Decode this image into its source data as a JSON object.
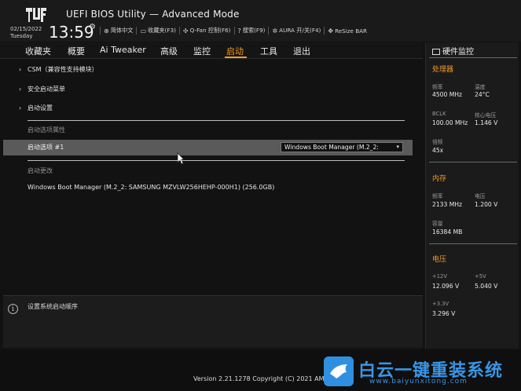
{
  "header": {
    "title": "UEFI BIOS Utility — Advanced Mode",
    "date": "02/15/2022",
    "weekday": "Tuesday",
    "time": "13:59",
    "toolbar": [
      {
        "icon": "globe-icon",
        "label": "简体中文"
      },
      {
        "icon": "favorites-icon",
        "label": "收藏夹(F3)"
      },
      {
        "icon": "fan-icon",
        "label": "Q-Fan 控制(F6)"
      },
      {
        "icon": "help-icon",
        "label": "搜索(F9)"
      },
      {
        "icon": "aura-icon",
        "label": "AURA 开/关(F4)"
      },
      {
        "icon": "resize-bar-icon",
        "label": "ReSize BAR"
      }
    ]
  },
  "menu": {
    "tabs": [
      "收藏夹",
      "概要",
      "Ai Tweaker",
      "高级",
      "监控",
      "启动",
      "工具",
      "退出"
    ],
    "active": "启动"
  },
  "main": {
    "items": [
      "CSM（兼容性支持模块）",
      "安全启动菜单",
      "启动设置"
    ],
    "boot_option_priorities_label": "启动选项属性",
    "boot_option_label": "启动选项 #1",
    "boot_option_value": "Windows Boot Manager (M.2_2:",
    "boot_override_label": "启动更改",
    "boot_override_entry": "Windows Boot Manager (M.2_2: SAMSUNG MZVLW256HEHP-000H1) (256.0GB)"
  },
  "help": {
    "text": "设置系统启动顺序"
  },
  "monitor": {
    "title": "硬件监控",
    "cpu": {
      "heading": "处理器",
      "freq_label": "频率",
      "freq_value": "4500 MHz",
      "temp_label": "温度",
      "temp_value": "24°C",
      "bclk_label": "BCLK",
      "bclk_value": "100.00 MHz",
      "vcore_label": "核心电压",
      "vcore_value": "1.146 V",
      "ratio_label": "倍频",
      "ratio_value": "45x"
    },
    "memory": {
      "heading": "内存",
      "freq_label": "频率",
      "freq_value": "2133 MHz",
      "volt_label": "电压",
      "volt_value": "1.200 V",
      "cap_label": "容量",
      "cap_value": "16384 MB"
    },
    "voltage": {
      "heading": "电压",
      "v12_label": "+12V",
      "v12_value": "12.096 V",
      "v5_label": "+5V",
      "v5_value": "5.040 V",
      "v33_label": "+3.3V",
      "v33_value": "3.296 V"
    }
  },
  "footer": {
    "version": "Version 2.21.1278 Copyright (C) 2021 AM"
  },
  "watermark": {
    "title": "白云一键重装系统",
    "url": "www.baiyunxitong.com"
  },
  "colors": {
    "accent": "#f39c22",
    "background": "#121213",
    "selected_row": "#5a5a5b",
    "watermark": "#3a95e4"
  }
}
